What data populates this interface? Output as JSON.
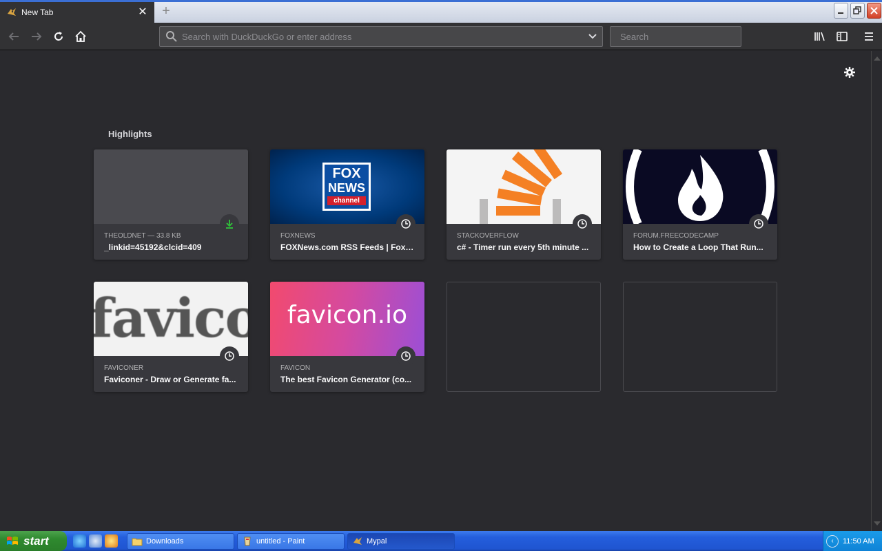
{
  "browser": {
    "tab": {
      "title": "New Tab"
    },
    "urlbar": {
      "placeholder": "Search with DuckDuckGo or enter address"
    },
    "searchbar": {
      "placeholder": "Search"
    }
  },
  "highlights": {
    "title": "Highlights",
    "cards": [
      {
        "hostname": "THEOLDNET — 33.8 KB",
        "title": "_linkid=45192&clcid=409",
        "badge": "download-icon"
      },
      {
        "hostname": "FOXNEWS",
        "title": "FOXNews.com RSS Feeds | Fox ...",
        "badge": "clock-icon",
        "logo_top": "FOX",
        "logo_mid": "NEWS",
        "logo_bottom": "channel"
      },
      {
        "hostname": "STACKOVERFLOW",
        "title": "c# - Timer run every 5th minute ...",
        "badge": "clock-icon"
      },
      {
        "hostname": "FORUM.FREECODECAMP",
        "title": "How to Create a Loop That Run...",
        "badge": "clock-icon"
      },
      {
        "hostname": "FAVICONER",
        "title": "Faviconer - Draw or Generate fa...",
        "badge": "clock-icon",
        "thumb_text": "favico"
      },
      {
        "hostname": "FAVICON",
        "title": "The best Favicon Generator (co...",
        "badge": "clock-icon",
        "thumb_text": "favicon.io"
      }
    ]
  },
  "taskbar": {
    "start_label": "start",
    "items": [
      {
        "label": "Downloads"
      },
      {
        "label": "untitled - Paint"
      },
      {
        "label": "Mypal"
      }
    ],
    "clock": "11:50 AM"
  },
  "colors": {
    "page_bg": "#2a2a2e",
    "card_bg": "#38383d",
    "download_green": "#30b93a",
    "fox_blue": "#003a7a",
    "so_orange": "#f48024",
    "fcc_dark": "#0a0a23"
  }
}
